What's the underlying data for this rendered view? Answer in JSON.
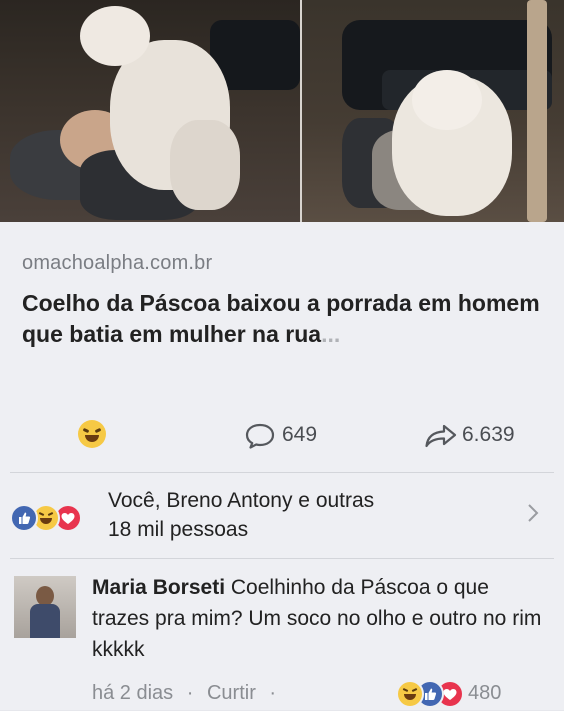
{
  "link": {
    "domain": "omachoalpha.com.br",
    "title_main": "Coelho da Páscoa baixou a porrada em homem que batia em mulher na rua",
    "title_ellipsis": "..."
  },
  "stats": {
    "reaction_icon": "laughing-emoji-icon",
    "comment_icon": "comment-bubble-icon",
    "comments": "649",
    "share_icon": "share-arrow-icon",
    "shares": "6.639"
  },
  "reactions": {
    "icons": [
      "like-icon",
      "haha-icon",
      "love-icon"
    ],
    "line1": "Você, Breno Antony e outras",
    "line2": "18 mil pessoas"
  },
  "comment": {
    "author": "Maria Borseti",
    "text": "Coelhinho da Páscoa o que trazes pra mim? Um soco no olho e outro no rim kkkkk",
    "time": "há 2 dias",
    "dot": "·",
    "like_label": "Curtir",
    "dot2": "·",
    "reaction_count": "480"
  },
  "colors": {
    "like_blue": "#4267b2",
    "love_red": "#e8344e",
    "haha_yellow": "#f6c945"
  }
}
